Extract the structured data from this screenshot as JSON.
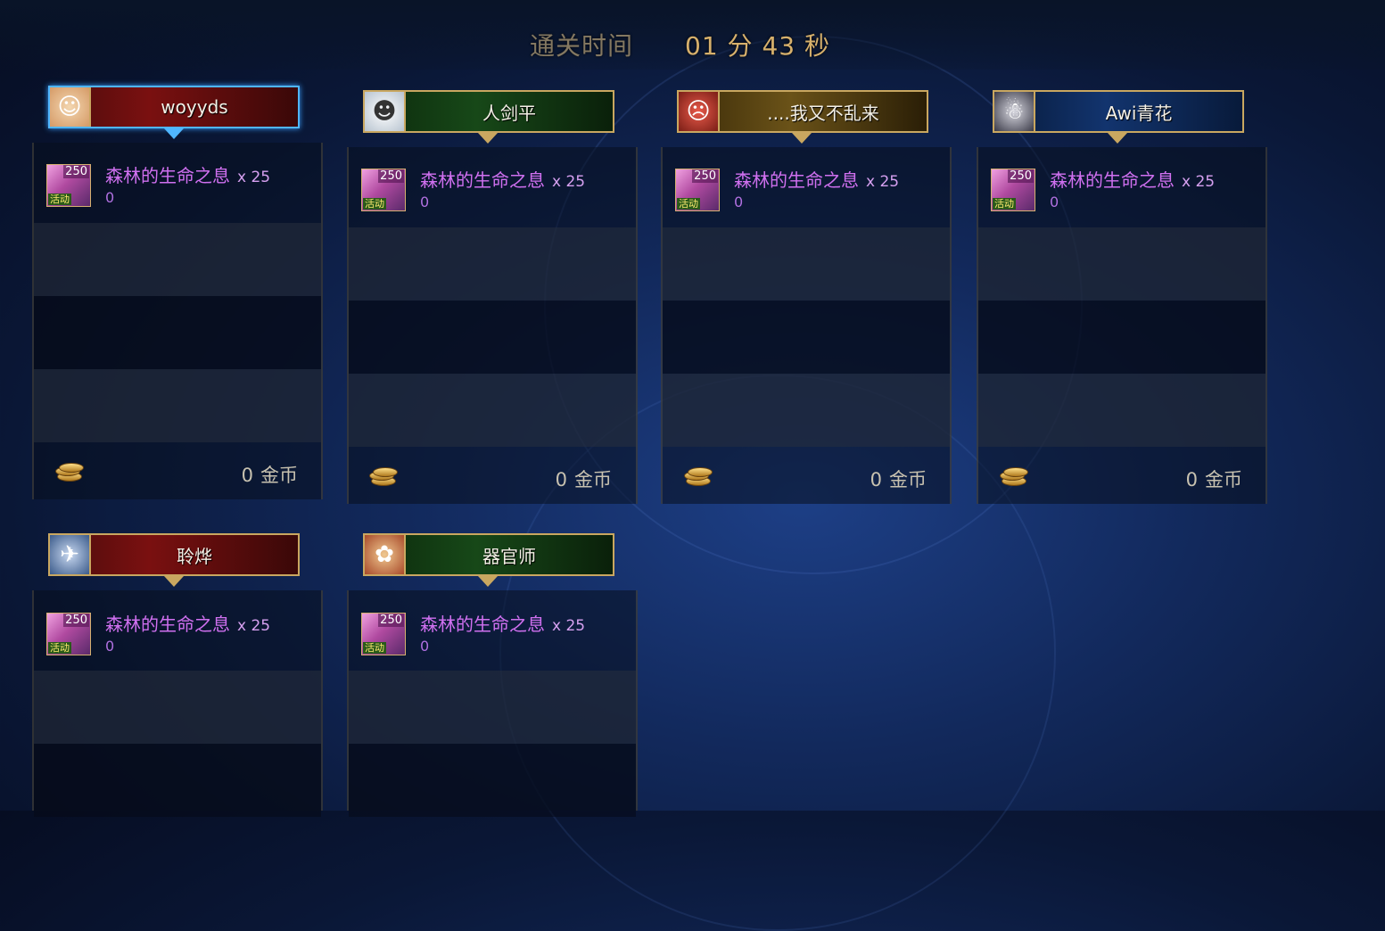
{
  "clear_time": {
    "label": "通关时间",
    "value": "01 分 43 秒"
  },
  "reward_item": {
    "name": "森林的生命之息",
    "multiplier": "x 25",
    "badge_number": "250",
    "badge_tag": "活动",
    "quantity_line": "0"
  },
  "gold_unit": "金币",
  "players": [
    {
      "name": "woyyds",
      "gold": "0",
      "bar_color": "red",
      "selected": true,
      "avatar_glyph": "☺"
    },
    {
      "name": "人剑平",
      "gold": "0",
      "bar_color": "green",
      "selected": false,
      "avatar_glyph": "☻"
    },
    {
      "name": "....我又不乱来",
      "gold": "0",
      "bar_color": "gold",
      "selected": false,
      "avatar_glyph": "☹"
    },
    {
      "name": "Awi青花",
      "gold": "0",
      "bar_color": "blue",
      "selected": false,
      "avatar_glyph": "☃"
    },
    {
      "name": "聆烨",
      "gold": "",
      "bar_color": "red",
      "selected": false,
      "avatar_glyph": "✈"
    },
    {
      "name": "器官师",
      "gold": "",
      "bar_color": "green",
      "selected": false,
      "avatar_glyph": "✿"
    }
  ]
}
